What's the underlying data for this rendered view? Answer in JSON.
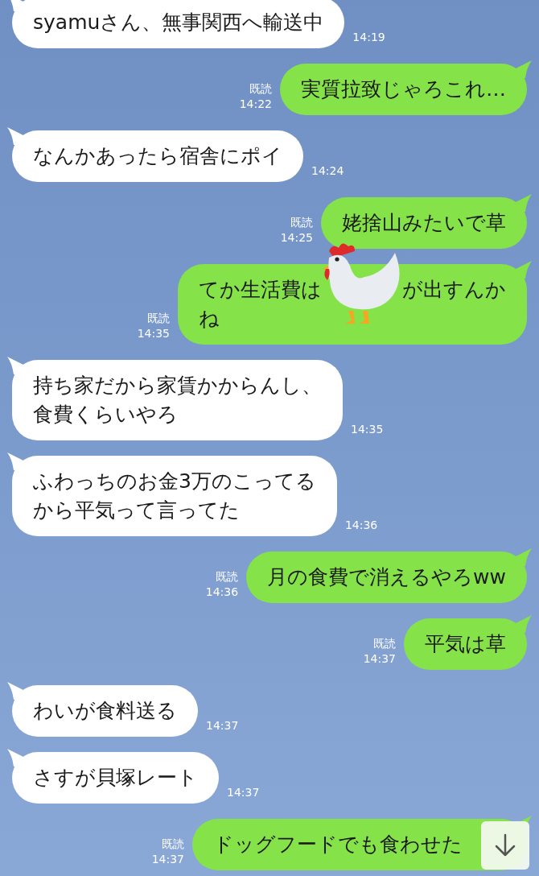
{
  "messages": [
    {
      "kind": "received",
      "lines": [
        "syamuさん、無事関西へ輸送中"
      ],
      "time": "14:19"
    },
    {
      "kind": "sent",
      "read_label": "既読",
      "lines": [
        "実質拉致じゃろこれ…"
      ],
      "time": "14:22"
    },
    {
      "kind": "received",
      "lines": [
        "なんかあったら宿舎にポイ"
      ],
      "time": "14:24"
    },
    {
      "kind": "sent",
      "read_label": "既読",
      "lines": [
        "姥捨山みたいで草"
      ],
      "time": "14:25"
    },
    {
      "kind": "sent",
      "read_label": "既読",
      "lines": [
        [
          "てか生活費は",
          "が出すんか"
        ],
        "ね"
      ],
      "time": "14:35"
    },
    {
      "kind": "received",
      "lines": [
        "持ち家だから家賃かからんし、",
        "食費くらいやろ"
      ],
      "time": "14:35"
    },
    {
      "kind": "received",
      "lines": [
        "ふわっちのお金3万のこってる",
        "から平気って言ってた"
      ],
      "time": "14:36"
    },
    {
      "kind": "sent",
      "read_label": "既読",
      "lines": [
        "月の食費で消えるやろww"
      ],
      "time": "14:36"
    },
    {
      "kind": "sent",
      "read_label": "既読",
      "lines": [
        "平気は草"
      ],
      "time": "14:37"
    },
    {
      "kind": "received",
      "lines": [
        "わいが食料送る"
      ],
      "time": "14:37"
    },
    {
      "kind": "received",
      "lines": [
        "さすが貝塚レート"
      ],
      "time": "14:37"
    },
    {
      "kind": "sent",
      "read_label": "既読",
      "lines": [
        "ドッグフードでも食わせた"
      ],
      "time": "14:37"
    }
  ]
}
